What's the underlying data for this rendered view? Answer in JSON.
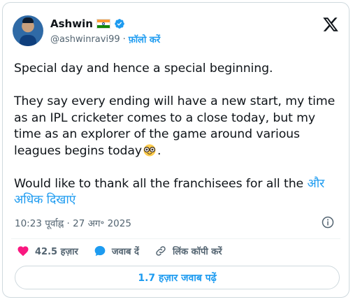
{
  "author": {
    "name": "Ashwin",
    "handle": "@ashwinravi99",
    "separator": "·",
    "follow_label": "फ़ॉलो करें"
  },
  "tweet": {
    "paragraph1": "Special day and hence a special beginning.",
    "paragraph2": "They say every ending will have a new start, my time as an IPL cricketer comes to a close today, but my time as an explorer of the game around various leagues begins today",
    "paragraph2_end": ".",
    "paragraph3": "Would like to thank all the franchisees for all the ",
    "show_more": "और अधिक दिखाएं"
  },
  "meta": {
    "timestamp": "10:23 पूर्वाह्न · 27 अग॰ 2025"
  },
  "actions": {
    "likes": "42.5 हज़ार",
    "reply": "जवाब दें",
    "copy_link": "लिंक कॉपी करें"
  },
  "read_replies": "1.7 हज़ार जवाब पढ़ें",
  "icons": {
    "verified": "verified-badge-icon",
    "flag": "india-flag-icon",
    "x": "x-logo-icon",
    "emoji": "nerd-face-emoji",
    "info": "info-icon",
    "heart": "heart-icon",
    "reply": "reply-bubble-icon",
    "link": "link-icon"
  },
  "colors": {
    "accent": "#1d9bf0",
    "like": "#f91880",
    "muted": "#536471",
    "text": "#0f1419"
  }
}
